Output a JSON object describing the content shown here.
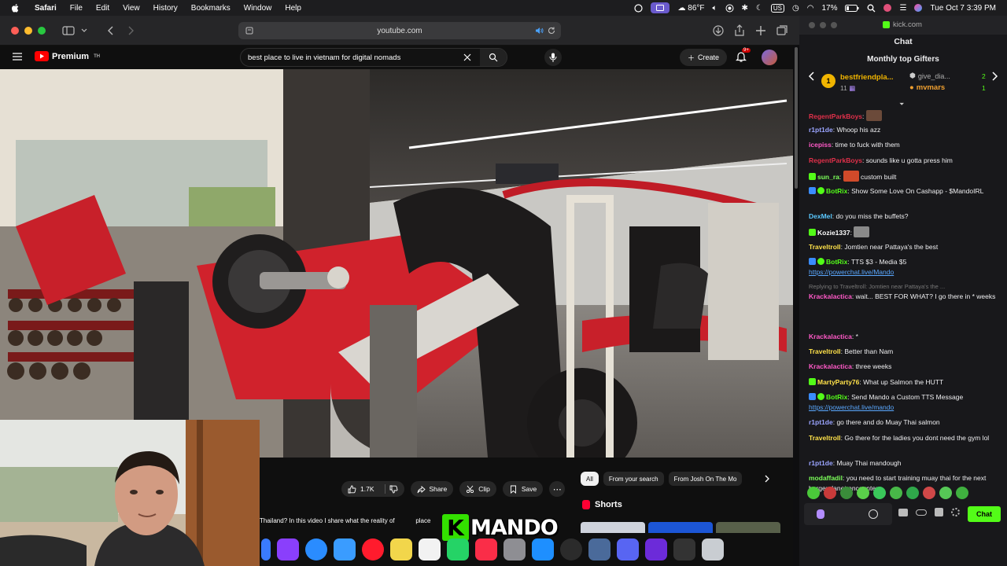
{
  "menubar": {
    "app": "Safari",
    "menus": [
      "File",
      "Edit",
      "View",
      "History",
      "Bookmarks",
      "Window",
      "Help"
    ],
    "weather": "86°F",
    "keyboard": "US",
    "battery": "17%",
    "clock": "Tue Oct 7  3:39 PM"
  },
  "safari": {
    "address": "youtube.com"
  },
  "youtube": {
    "logo_text": "Premium",
    "logo_sup": "TH",
    "search_query": "best place to live in vietnam for digital nomads",
    "create_label": "Create",
    "notif_badge": "9+",
    "actions": {
      "likes": "1.7K",
      "share": "Share",
      "clip": "Clip",
      "save": "Save"
    },
    "chips": [
      "All",
      "From your search",
      "From Josh On The Mo"
    ],
    "shorts_label": "Shorts",
    "description_snippet": "Thailand? In this video I share what the reality of",
    "description_tail": "place"
  },
  "overlay": {
    "logo_letter": "K",
    "logo_word": "MANDO"
  },
  "kick": {
    "url": "kick.com",
    "chat_title": "Chat",
    "gifters_title": "Monthly top Gifters",
    "gifters": [
      {
        "rank": "1",
        "name": "bestfriendpla...",
        "count": "11"
      },
      {
        "name": "give_dia...",
        "count": "2"
      },
      {
        "name": "mvmars",
        "count": "1"
      }
    ],
    "messages": [
      {
        "user": "RegentParkBoys",
        "text": ""
      },
      {
        "user": "r1pt1de",
        "text": "Whoop his azz"
      },
      {
        "user": "icepiss",
        "text": "time to fuck with them"
      },
      {
        "user": "RegentParkBoys",
        "text": "sounds like u gotta press him"
      },
      {
        "user": "sun_ra",
        "text": "custom built"
      },
      {
        "user": "BotRix",
        "text": "Show Some Love On Cashapp - $MandoIRL"
      },
      {
        "user": "DexMel",
        "text": "do you miss the buffets?"
      },
      {
        "user": "Kozie1337",
        "text": ""
      },
      {
        "user": "Traveltroll",
        "text": "Jomtien near Pattaya's the best"
      },
      {
        "user": "BotRix",
        "text": "TTS $3 - Media $5",
        "link": "https://powerchat.live/Mando"
      },
      {
        "reply": "Replying to Traveltroll: Jomtien near Pattaya's the ...",
        "user": "Krackalactica",
        "text": "wait... BEST FOR WHAT? I go there in * weeks"
      },
      {
        "user": "Krackalactica",
        "text": "*"
      },
      {
        "user": "Traveltroll",
        "text": "Better than Nam"
      },
      {
        "user": "Krackalactica",
        "text": "three weeks"
      },
      {
        "user": "MartyParty76",
        "text": "What up Salmon the HUTT"
      },
      {
        "user": "BotRix",
        "text": "Send Mando a Custom TTS Message",
        "link": "https://powerchat.live/mando"
      },
      {
        "user": "r1pt1de",
        "text": "go there and do Muay Thai salmon"
      },
      {
        "user": "Traveltroll",
        "text": "Go there for the ladies you dont need the gym lol"
      },
      {
        "user": "r1pt1de",
        "text": "Muay Thai mandough"
      },
      {
        "user": "modaffadil",
        "text": "you need to start training muay thai for the next burgerplanet encounter"
      }
    ],
    "chat_button": "Chat"
  },
  "colors": {
    "kick_green": "#53fc18",
    "yt_red": "#ff0000"
  }
}
